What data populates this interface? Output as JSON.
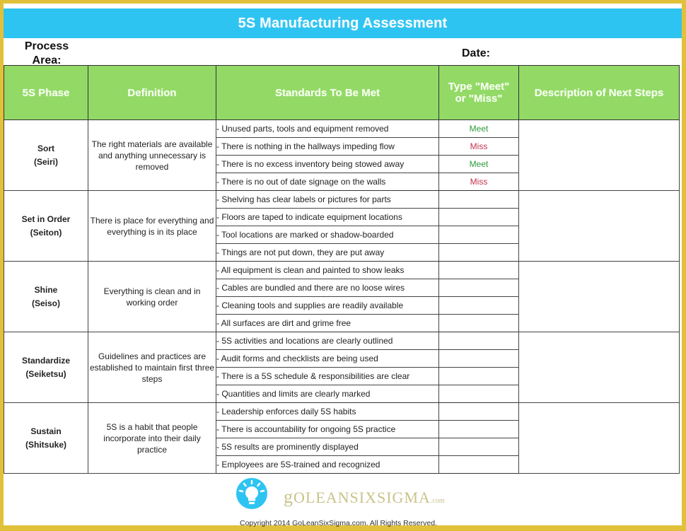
{
  "header": {
    "title": "5S Manufacturing Assessment",
    "process_area_label": "Process Area:",
    "date_label": "Date:"
  },
  "table": {
    "columns": [
      "5S Phase",
      "Definition",
      "Standards To Be Met",
      "Type \"Meet\" or \"Miss\"",
      "Description of Next Steps"
    ],
    "phases": [
      {
        "name": "Sort",
        "japanese": "(Seiri)",
        "definition": "The right materials are available and anything unnecessary is removed",
        "standards": [
          {
            "text": "- Unused parts, tools and equipment removed",
            "result": "Meet"
          },
          {
            "text": "- There is nothing in the hallways impeding flow",
            "result": "Miss"
          },
          {
            "text": "- There is no excess inventory being stowed away",
            "result": "Meet"
          },
          {
            "text": "- There is no out of date signage on the walls",
            "result": "Miss"
          }
        ]
      },
      {
        "name": "Set in Order",
        "japanese": "(Seiton)",
        "definition": "There is place for everything and everything is in its place",
        "standards": [
          {
            "text": "- Shelving has clear labels or pictures for parts",
            "result": ""
          },
          {
            "text": "- Floors are taped to indicate equipment locations",
            "result": ""
          },
          {
            "text": "- Tool locations are marked or shadow-boarded",
            "result": ""
          },
          {
            "text": "- Things are not put down, they are put away",
            "result": ""
          }
        ]
      },
      {
        "name": "Shine",
        "japanese": "(Seiso)",
        "definition": "Everything is clean and in working order",
        "standards": [
          {
            "text": "- All equipment is clean and painted to show leaks",
            "result": ""
          },
          {
            "text": "- Cables are bundled and there are no loose wires",
            "result": ""
          },
          {
            "text": "- Cleaning tools and supplies are readily available",
            "result": ""
          },
          {
            "text": "- All surfaces are dirt and grime free",
            "result": ""
          }
        ]
      },
      {
        "name": "Standardize",
        "japanese": "(Seiketsu)",
        "definition": "Guidelines and practices are established to maintain first three steps",
        "standards": [
          {
            "text": "- 5S activities and locations are clearly outlined",
            "result": ""
          },
          {
            "text": "- Audit forms and checklists are being used",
            "result": ""
          },
          {
            "text": "- There is a 5S schedule & responsibilities are clear",
            "result": ""
          },
          {
            "text": "- Quantities and limits are clearly marked",
            "result": ""
          }
        ]
      },
      {
        "name": "Sustain",
        "japanese": "(Shitsuke)",
        "definition": "5S is a habit that people incorporate into their daily practice",
        "standards": [
          {
            "text": "- Leadership enforces daily 5S habits",
            "result": ""
          },
          {
            "text": "- There is accountability for ongoing 5S practice",
            "result": ""
          },
          {
            "text": "- 5S results are prominently displayed",
            "result": ""
          },
          {
            "text": "- Employees are 5S-trained and recognized",
            "result": ""
          }
        ]
      }
    ]
  },
  "footer": {
    "logo_icon": "lightbulb-icon",
    "logo_text_g": "g",
    "logo_text_main": "OLEANSIXSIGMA",
    "logo_text_suffix": ".com",
    "copyright": "Copyright 2014 GoLeanSixSigma.com. All Rights Reserved."
  },
  "colors": {
    "title_bar": "#2ec4f2",
    "header_row": "#93d966",
    "meet": "#2e9a3e",
    "miss": "#c3324e",
    "frame": "#e2c13a"
  }
}
